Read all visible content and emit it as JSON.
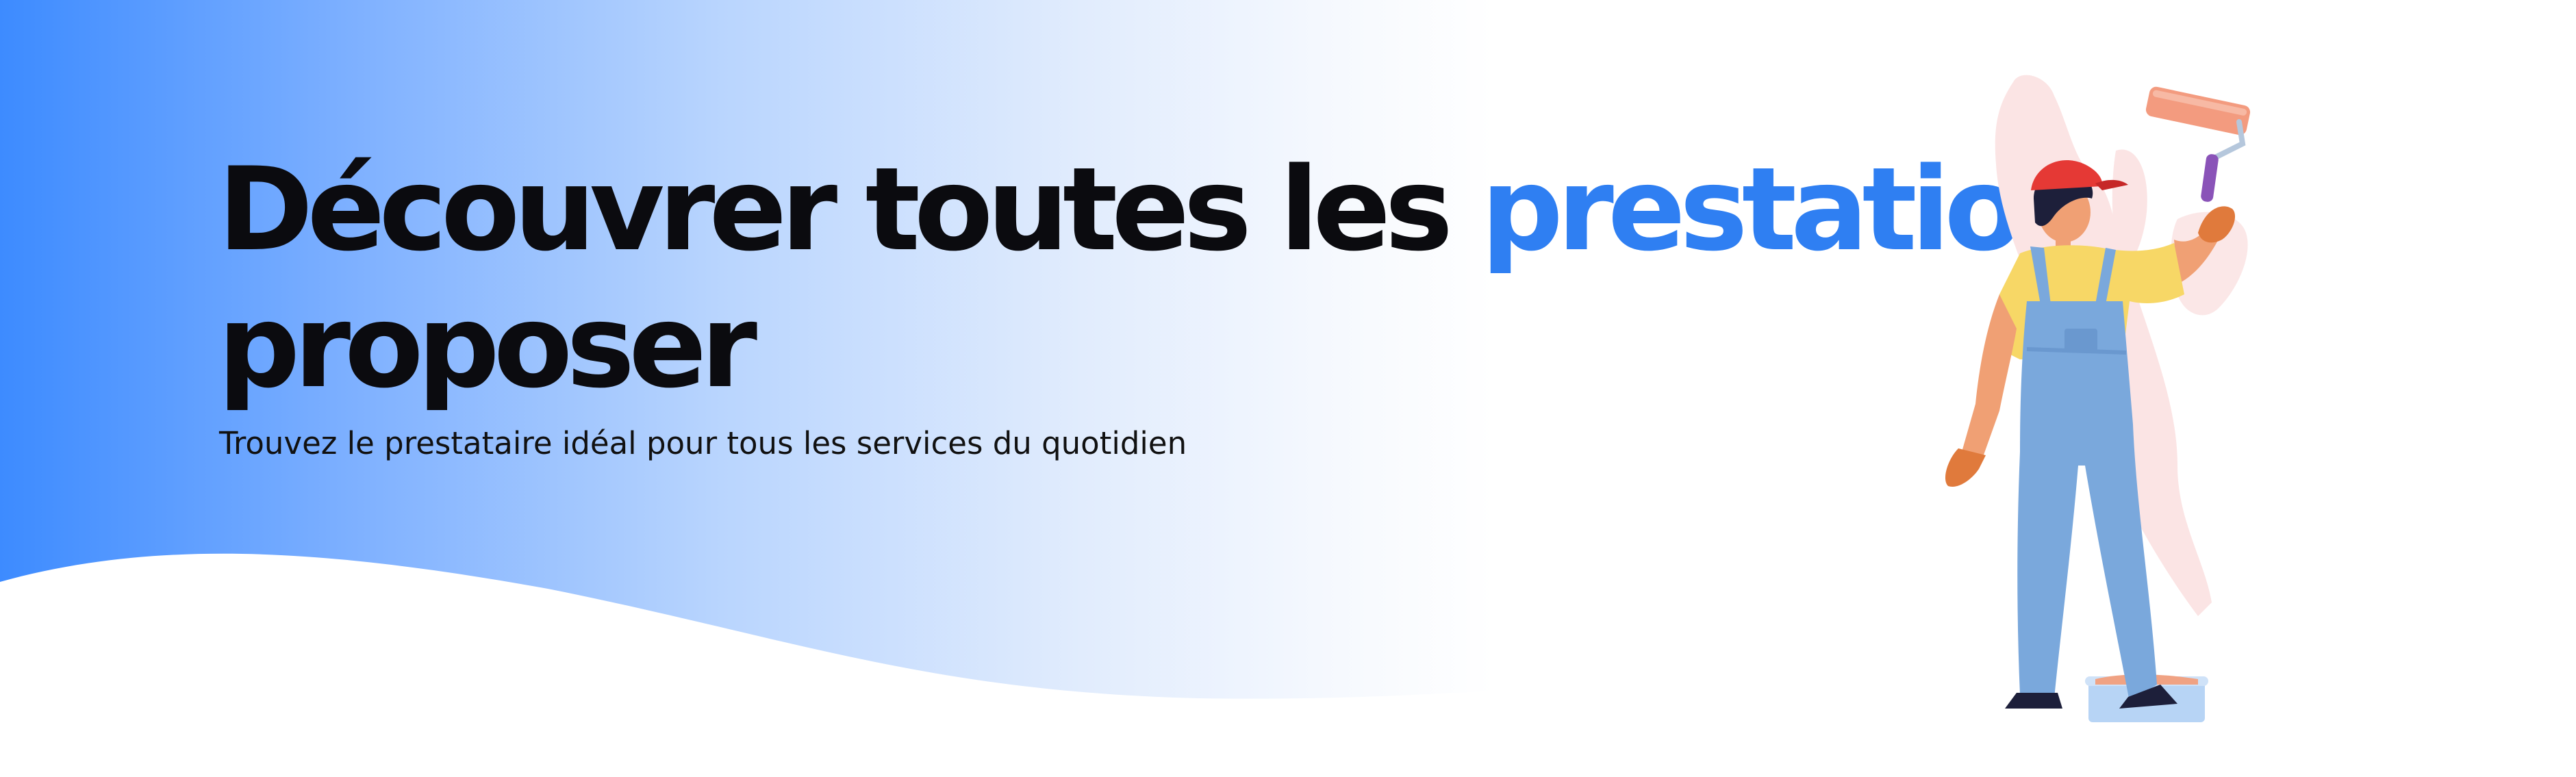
{
  "hero": {
    "title_main": "Découvrer toutes les ",
    "title_accent": "prestation",
    "title_line2": "proposer",
    "subtitle": "Trouvez le prestataire idéal pour tous les services du quotidien"
  },
  "illustration": {
    "icon": "painter-illustration"
  },
  "colors": {
    "accent": "#2f7ff2",
    "gradient_start": "#3d8bff",
    "text_dark": "#0b0b0f"
  }
}
